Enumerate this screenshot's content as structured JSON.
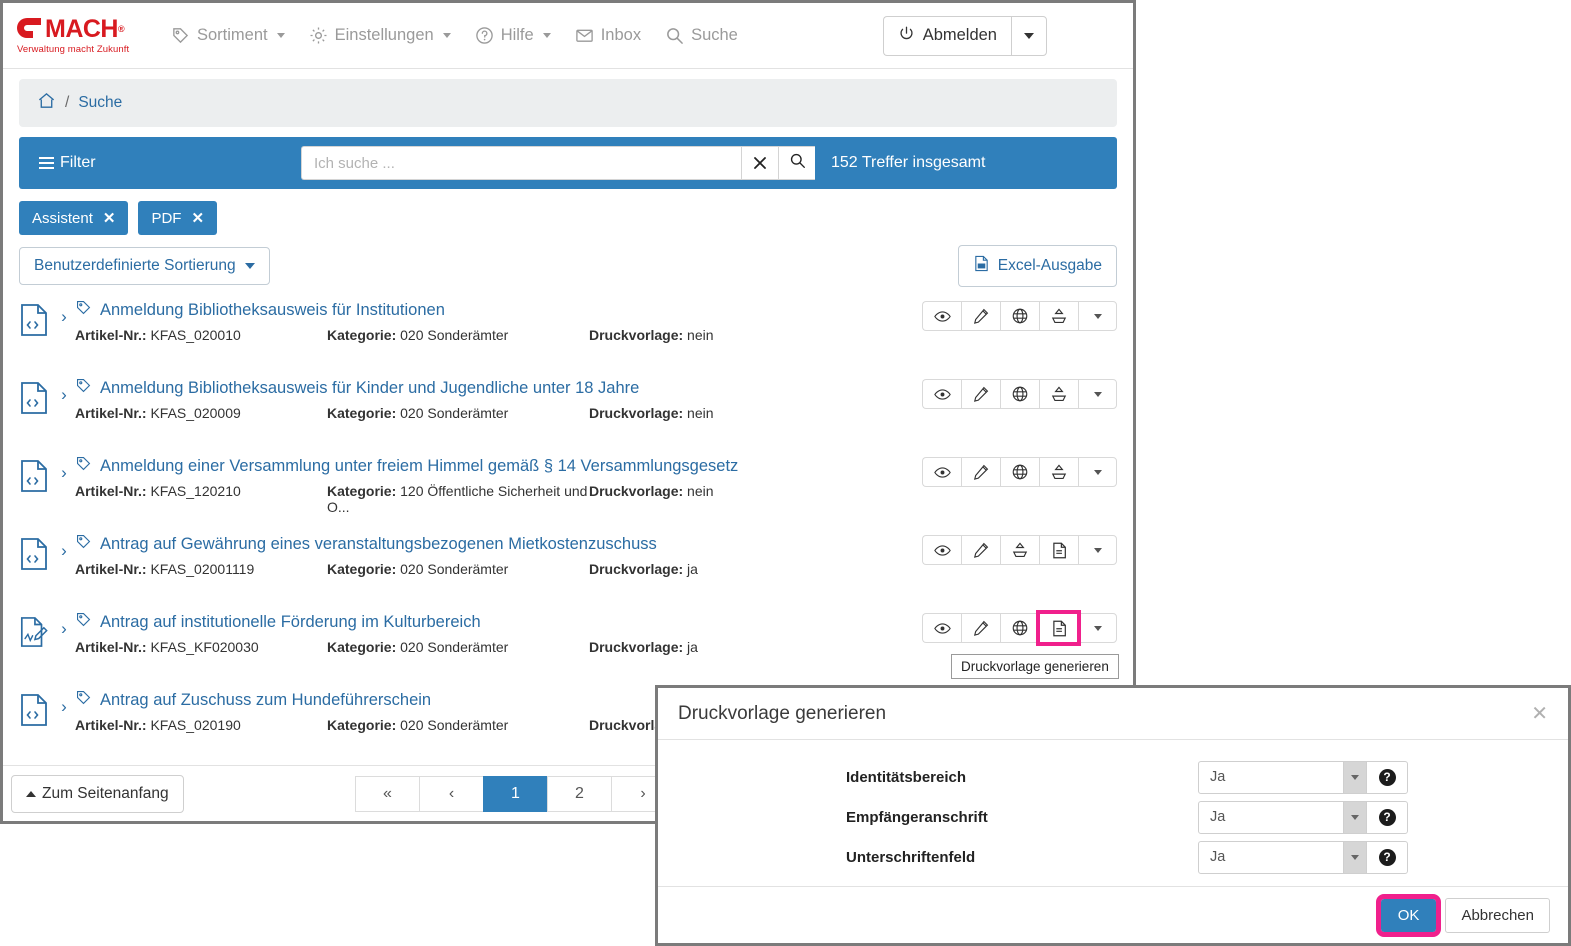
{
  "app": {
    "logo": {
      "word": "MACH",
      "registered": "®",
      "tagline": "Verwaltung macht Zukunft"
    },
    "nav": [
      {
        "label": "Sortiment",
        "icon": "tag-icon",
        "caret": true
      },
      {
        "label": "Einstellungen",
        "icon": "gear-icon",
        "caret": true
      },
      {
        "label": "Hilfe",
        "icon": "question-circle-icon",
        "caret": true
      },
      {
        "label": "Inbox",
        "icon": "envelope-icon",
        "caret": false
      },
      {
        "label": "Suche",
        "icon": "search-icon",
        "caret": false
      }
    ],
    "logout": {
      "label": "Abmelden",
      "icon": "power-icon"
    }
  },
  "breadcrumb": {
    "home_icon": "home-icon",
    "separator": "/",
    "current": "Suche"
  },
  "search": {
    "filter_label": "Filter",
    "placeholder": "Ich suche ...",
    "value": "",
    "clear_label": "✕",
    "hits": "152 Treffer insgesamt"
  },
  "chips": [
    {
      "label": "Assistent",
      "close": "✕"
    },
    {
      "label": "PDF",
      "close": "✕"
    }
  ],
  "toolbar": {
    "sort_label": "Benutzerdefinierte Sortierung",
    "excel_label": "Excel-Ausgabe"
  },
  "list": {
    "labels": {
      "artikel": "Artikel-Nr.:",
      "kategorie": "Kategorie:",
      "druckvorlage": "Druckvorlage:"
    },
    "rows": [
      {
        "doc_icon": "code-document-icon",
        "title": "Anmeldung Bibliotheksausweis für Institutionen",
        "artikel": "KFAS_020010",
        "kategorie": "020 Sonderämter",
        "druckvorlage": "nein",
        "actions": [
          "eye-icon",
          "pencil-icon",
          "globe-icon",
          "upload-tray-icon",
          "caret-down-icon"
        ],
        "highlight_index": -1
      },
      {
        "doc_icon": "code-document-icon",
        "title": "Anmeldung Bibliotheksausweis für Kinder und Jugendliche unter 18 Jahre",
        "artikel": "KFAS_020009",
        "kategorie": "020 Sonderämter",
        "druckvorlage": "nein",
        "actions": [
          "eye-icon",
          "pencil-icon",
          "globe-icon",
          "upload-tray-icon",
          "caret-down-icon"
        ],
        "highlight_index": -1
      },
      {
        "doc_icon": "code-document-icon",
        "title": "Anmeldung einer Versammlung unter freiem Himmel gemäß § 14 Versammlungsgesetz",
        "artikel": "KFAS_120210",
        "kategorie": "120 Öffentliche Sicherheit und O...",
        "druckvorlage": "nein",
        "actions": [
          "eye-icon",
          "pencil-icon",
          "globe-icon",
          "upload-tray-icon",
          "caret-down-icon"
        ],
        "highlight_index": -1
      },
      {
        "doc_icon": "code-document-icon",
        "title": "Antrag auf Gewährung eines veranstaltungsbezogenen Mietkostenzuschuss",
        "artikel": "KFAS_02001119",
        "kategorie": "020 Sonderämter",
        "druckvorlage": "ja",
        "actions": [
          "eye-icon",
          "pencil-icon",
          "upload-tray-icon",
          "file-text-icon",
          "caret-down-icon"
        ],
        "highlight_index": -1
      },
      {
        "doc_icon": "signed-document-icon",
        "title": "Antrag auf institutionelle Förderung im Kulturbereich",
        "artikel": "KFAS_KF020030",
        "kategorie": "020 Sonderämter",
        "druckvorlage": "ja",
        "actions": [
          "eye-icon",
          "pencil-icon",
          "globe-icon",
          "file-text-icon",
          "caret-down-icon"
        ],
        "highlight_index": 3
      },
      {
        "doc_icon": "code-document-icon",
        "title": "Antrag auf Zuschuss zum Hundeführerschein",
        "artikel": "KFAS_020190",
        "kategorie": "020 Sonderämter",
        "druckvorlage": "",
        "actions": [],
        "highlight_index": -1
      }
    ]
  },
  "tooltip": {
    "text": "Druckvorlage generieren"
  },
  "footer": {
    "top_label": "Zum Seitenanfang",
    "pages": [
      {
        "label": "«",
        "active": false
      },
      {
        "label": "‹",
        "active": false
      },
      {
        "label": "1",
        "active": true
      },
      {
        "label": "2",
        "active": false
      },
      {
        "label": "›",
        "active": false
      }
    ]
  },
  "modal": {
    "title": "Druckvorlage generieren",
    "close": "✕",
    "fields": [
      {
        "label": "Identitätsbereich",
        "value": "Ja",
        "help": "?"
      },
      {
        "label": "Empfängeranschrift",
        "value": "Ja",
        "help": "?"
      },
      {
        "label": "Unterschriftenfeld",
        "value": "Ja",
        "help": "?"
      }
    ],
    "ok_label": "OK",
    "cancel_label": "Abbrechen"
  },
  "colors": {
    "brand_red": "#d81a20",
    "accent_blue": "#3080bb",
    "link_blue": "#2b6ca3",
    "highlight_magenta": "#f0208c",
    "breadcrumb_bg": "#eceeef"
  }
}
